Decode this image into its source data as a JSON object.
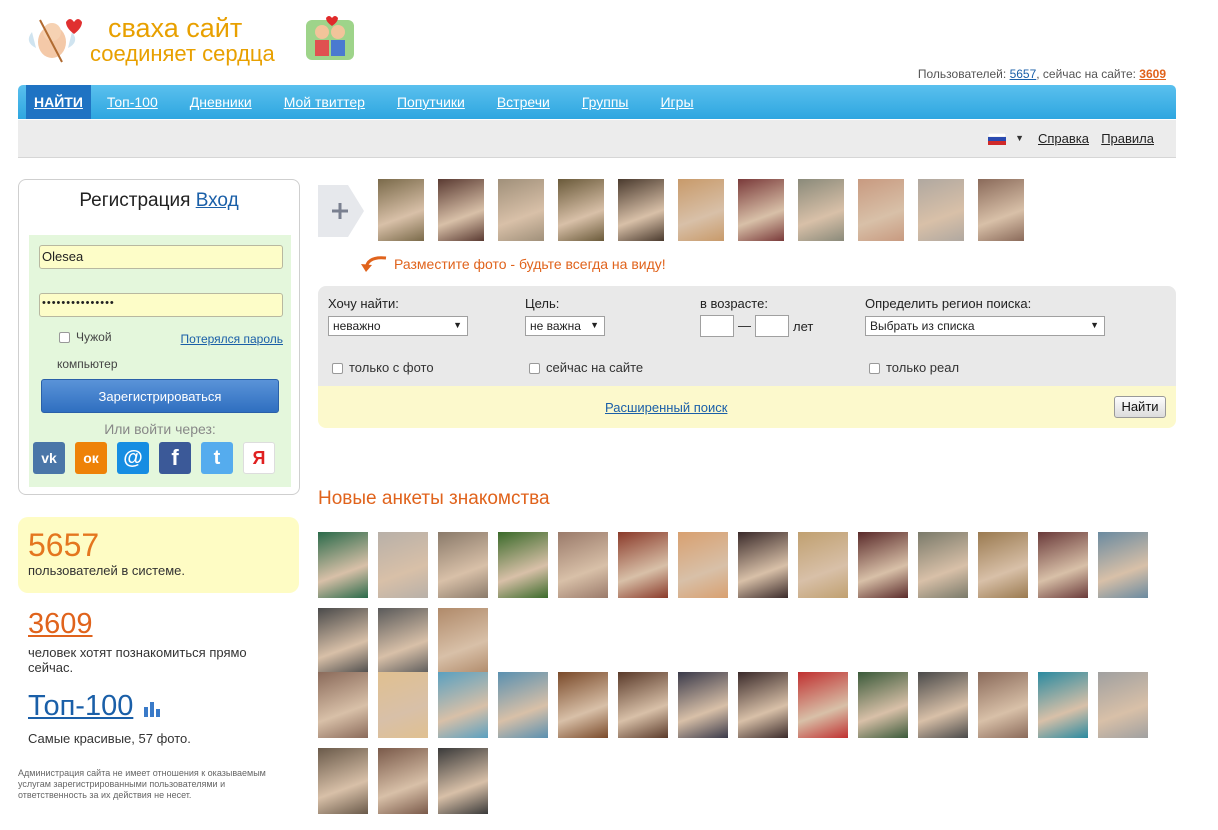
{
  "header": {
    "logo_line1": "сваха сайт",
    "logo_line2": "соединяет сердца",
    "users_label": "Пользователей:",
    "users_count": "5657",
    "online_label": ", сейчас на сайте:",
    "online_count": "3609"
  },
  "nav": {
    "items": [
      {
        "label": "НАЙТИ",
        "active": true
      },
      {
        "label": "Топ-100"
      },
      {
        "label": "Дневники"
      },
      {
        "label": "Мой твиттер"
      },
      {
        "label": "Попутчики"
      },
      {
        "label": "Встречи"
      },
      {
        "label": "Группы"
      },
      {
        "label": "Игры"
      }
    ]
  },
  "subbar": {
    "help": "Справка",
    "rules": "Правила"
  },
  "registration": {
    "title": "Регистрация",
    "login_link": "Вход",
    "username_value": "Olesea",
    "password_value": "•••••••••••••••",
    "foreign_pc_line1": "Чужой",
    "foreign_pc_line2": "компьютер",
    "lost_password": "Потерялся пароль",
    "register_button": "Зарегистрироваться",
    "or_login_via": "Или войти через:",
    "socials": [
      {
        "name": "vk",
        "glyph": "vk",
        "color": "#4a76a8"
      },
      {
        "name": "odnoklassniki",
        "glyph": "ок",
        "color": "#ee8208"
      },
      {
        "name": "mail",
        "glyph": "@",
        "color": "#168de2"
      },
      {
        "name": "facebook",
        "glyph": "f",
        "color": "#3b5998"
      },
      {
        "name": "twitter",
        "glyph": "t",
        "color": "#55acee"
      },
      {
        "name": "yandex",
        "glyph": "Я",
        "color": "#ffffff"
      }
    ]
  },
  "stats": {
    "users_count": "5657",
    "users_text": "пользователей в системе.",
    "online_count": "3609",
    "online_text": "человек хотят познакомиться прямо сейчас.",
    "top_label": "Топ-100",
    "top_text": "Самые красивые, 57 фото.",
    "disclaimer": "Администрация сайта не имеет отношения к оказываемым услугам зарегистрированными пользователями и ответственность за их действия не несет."
  },
  "photo_strip": {
    "post_photo_text": "Разместите фото - будьте всегда на виду!",
    "colors": [
      "#7a6a4a",
      "#5a3a32",
      "#a0907a",
      "#6a5a3a",
      "#4a3a2e",
      "#c89a6a",
      "#7a3a3a",
      "#8a8a7a",
      "#c89a80",
      "#b0a8a0",
      "#8a6a5a"
    ]
  },
  "search": {
    "want_label": "Хочу найти:",
    "want_value": "неважно",
    "goal_label": "Цель:",
    "goal_value": "не важна",
    "age_label": "в возрасте:",
    "age_sep": "—",
    "age_unit": "лет",
    "region_label": "Определить регион поиска:",
    "region_value": "Выбрать из списка",
    "opt_photo": "только с фото",
    "opt_online": "сейчас на сайте",
    "opt_real": "только реал",
    "advanced": "Расширенный поиск",
    "find_button": "Найти"
  },
  "new_profiles": {
    "title": "Новые анкеты знакомства",
    "row1_colors": [
      "#2a6a4a",
      "#b8b0a8",
      "#8a7a6a",
      "#3a6a2a",
      "#9a7a6a",
      "#8a3a2a",
      "#d8a070",
      "#3a2a2a",
      "#c0a070",
      "#5a2a2a",
      "#7a7a6a",
      "#9a7a50",
      "#6a3a3a",
      "#6a8aa0",
      "#4a4a4a",
      "#5a5a5a",
      "#b08a6a"
    ],
    "row2_colors": [
      "#8a6a5a",
      "#e0c090",
      "#5aa0c0",
      "#5a90b0",
      "#7a4a2a",
      "#5a3a2a",
      "#3a3a4a",
      "#3a2a2a",
      "#c03030",
      "#3a5a3a",
      "#4a4a4a",
      "#8a6a5a",
      "#2a8aa0",
      "#a0a0a0",
      "#6a5a4a",
      "#7a5a4a",
      "#3a3a3a"
    ]
  }
}
